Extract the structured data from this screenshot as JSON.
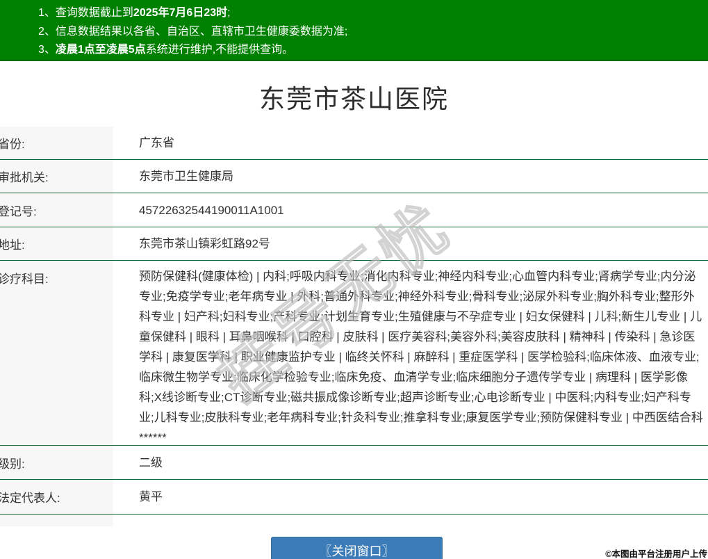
{
  "banner": {
    "bg_color": "#008000",
    "notices": [
      {
        "num": "1、",
        "pre": "查询数据截止到",
        "bold": "2025年7月6日23时",
        "post": ";"
      },
      {
        "num": "2、",
        "pre": "信息数据结果以各省、自治区、直辖市卫生健康委数据为准;",
        "bold": "",
        "post": ""
      },
      {
        "num": "3、",
        "pre": "",
        "bold": "凌晨1点至凌晨5点",
        "post": "系统进行维护,不能提供查询。"
      }
    ]
  },
  "hospital": {
    "title": "东莞市茶山医院"
  },
  "table": {
    "border_color": "#0b6130",
    "label_bg": "#f7f7f7",
    "rows": [
      {
        "label": "省份:",
        "value": "广东省"
      },
      {
        "label": "审批机关:",
        "value": "东莞市卫生健康局"
      },
      {
        "label": "登记号:",
        "value": "45722632544190011A1001"
      },
      {
        "label": "地址:",
        "value": "东莞市茶山镇彩虹路92号"
      },
      {
        "label": "诊疗科目:",
        "value": "预防保健科(健康体检) | 内科;呼吸内科专业;消化内科专业;神经内科专业;心血管内科专业;肾病学专业;内分泌专业;免疫学专业;老年病专业 | 外科;普通外科专业;神经外科专业;骨科专业;泌尿外科专业;胸外科专业;整形外科专业 | 妇产科;妇科专业;产科专业;计划生育专业;生殖健康与不孕症专业 | 妇女保健科 | 儿科;新生儿专业 | 儿童保健科 | 眼科 | 耳鼻咽喉科 | 口腔科 | 皮肤科 | 医疗美容科;美容外科;美容皮肤科 | 精神科 | 传染科 | 急诊医学科 | 康复医学科 | 职业健康监护专业 | 临终关怀科 | 麻醉科 | 重症医学科 | 医学检验科;临床体液、血液专业;临床微生物学专业;临床化学检验专业;临床免疫、血清学专业;临床细胞分子遗传学专业 | 病理科 | 医学影像科;X线诊断专业;CT诊断专业;磁共振成像诊断专业;超声诊断专业;心电诊断专业 | 中医科;内科专业;妇产科专业;儿科专业;皮肤科专业;老年病科专业;针灸科专业;推拿科专业;康复医学专业;预防保健科专业 | 中西医结合科******"
      },
      {
        "label": "级别:",
        "value": "二级"
      },
      {
        "label": "法定代表人:",
        "value": "黄平"
      }
    ]
  },
  "close_button": {
    "label": "〖关闭窗口〗",
    "bg_color": "#3b7cb8"
  },
  "watermark": {
    "text": "挂号无忧"
  },
  "footer": {
    "credit": "©本图由平台注册用户上传"
  }
}
